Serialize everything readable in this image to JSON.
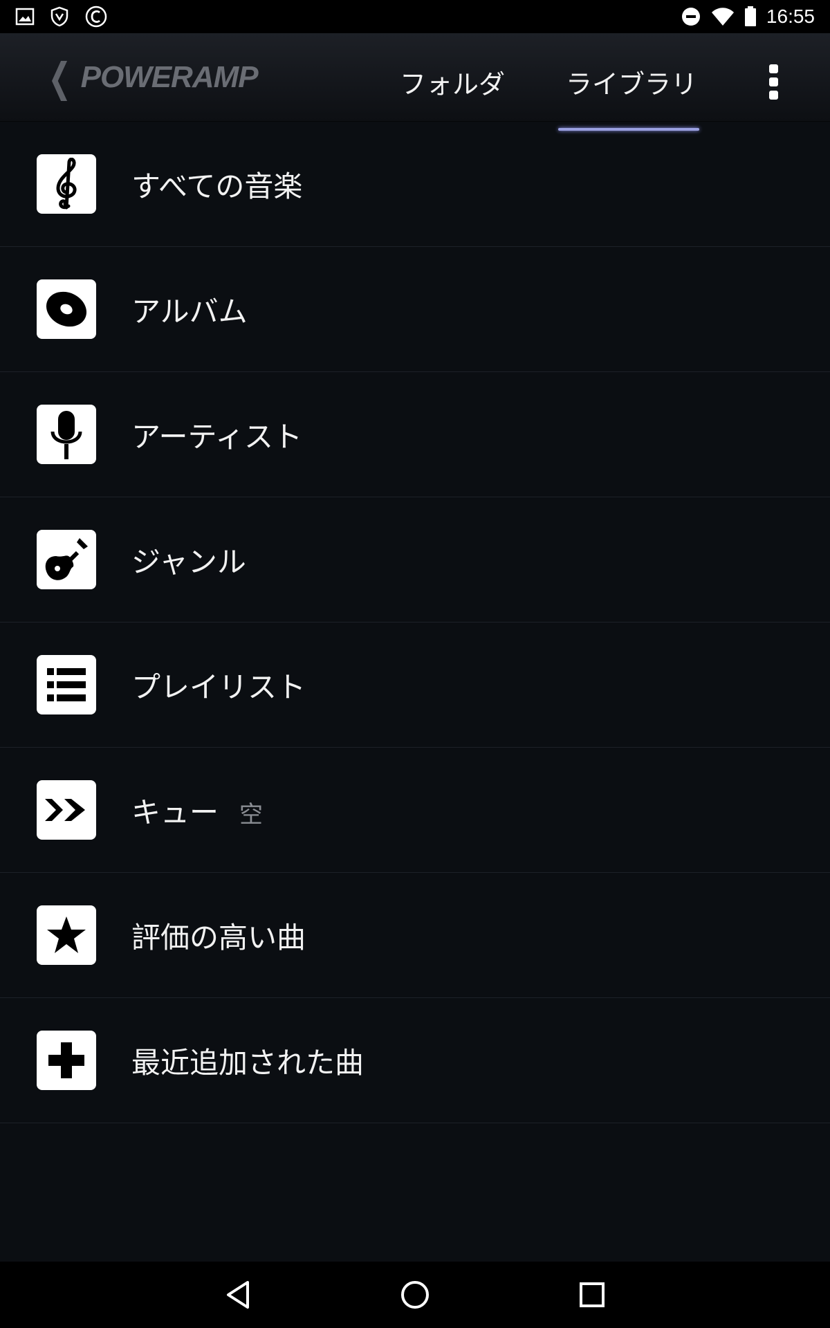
{
  "status_bar": {
    "time": "16:55",
    "left_icons": [
      "image-icon",
      "shield-icon",
      "copyright-icon"
    ],
    "right_icons": [
      "dnd-icon",
      "wifi-icon",
      "battery-icon"
    ]
  },
  "app_bar": {
    "logo_text": "POWERAMP",
    "tabs": [
      {
        "label": "フォルダ",
        "selected": false
      },
      {
        "label": "ライブラリ",
        "selected": true
      }
    ],
    "accent_color": "#9aa0e0"
  },
  "library_items": [
    {
      "label": "すべての音楽",
      "sub": "",
      "icon": "treble-clef-icon"
    },
    {
      "label": "アルバム",
      "sub": "",
      "icon": "disc-icon"
    },
    {
      "label": "アーティスト",
      "sub": "",
      "icon": "microphone-icon"
    },
    {
      "label": "ジャンル",
      "sub": "",
      "icon": "guitar-icon"
    },
    {
      "label": "プレイリスト",
      "sub": "",
      "icon": "list-icon"
    },
    {
      "label": "キュー",
      "sub": "空",
      "icon": "queue-forward-icon"
    },
    {
      "label": "評価の高い曲",
      "sub": "",
      "icon": "star-icon"
    },
    {
      "label": "最近追加された曲",
      "sub": "",
      "icon": "plus-icon"
    }
  ],
  "nav_bar": {
    "buttons": [
      "back-icon",
      "home-icon",
      "recents-icon"
    ]
  }
}
